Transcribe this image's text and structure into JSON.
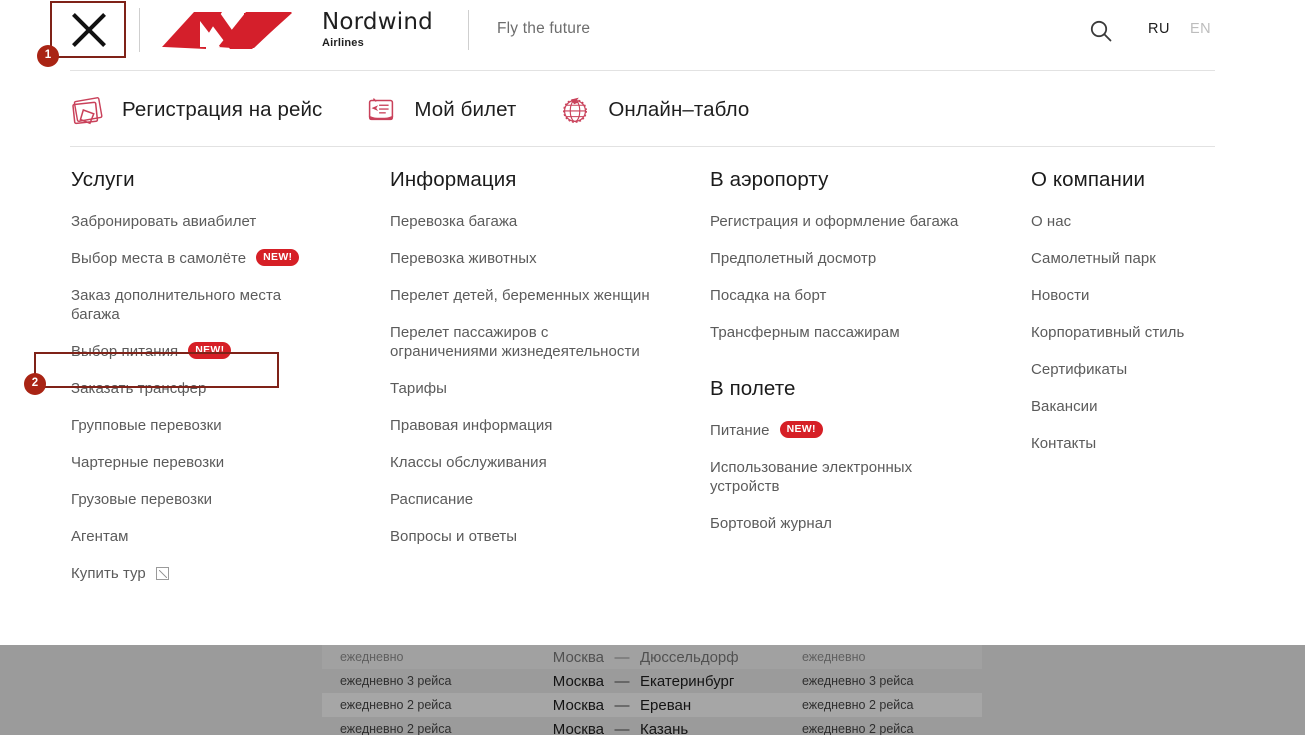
{
  "header": {
    "close_button": "close-icon",
    "brand": {
      "name": "Nordwind",
      "sub": "Airlines"
    },
    "tagline": "Fly the future",
    "search_icon": "search-icon",
    "lang_ru": "RU",
    "lang_en": "EN"
  },
  "quicknav": [
    {
      "icon": "boarding-pass-icon",
      "label": "Регистрация на рейс"
    },
    {
      "icon": "ticket-icon",
      "label": "Мой билет"
    },
    {
      "icon": "globe-plane-icon",
      "label": "Онлайн–табло"
    }
  ],
  "columns": [
    {
      "title": "Услуги",
      "items": [
        {
          "label": "Забронировать авиабилет"
        },
        {
          "label": "Выбор места в самолёте",
          "badge": "NEW!"
        },
        {
          "label": "Заказ дополнительного места\nбагажа"
        },
        {
          "label": "Выбор питания",
          "badge": "NEW!",
          "highlighted": true
        },
        {
          "label": "Заказать трансфер"
        },
        {
          "label": "Групповые перевозки"
        },
        {
          "label": "Чартерные перевозки"
        },
        {
          "label": "Грузовые перевозки"
        },
        {
          "label": "Агентам"
        },
        {
          "label": "Купить тур",
          "external": true
        }
      ]
    },
    {
      "title": "Информация",
      "items": [
        {
          "label": "Перевозка багажа"
        },
        {
          "label": "Перевозка животных"
        },
        {
          "label": "Перелет детей, беременных женщин"
        },
        {
          "label": "Перелет пассажиров с\nограничениями жизнедеятельности"
        },
        {
          "label": "Тарифы"
        },
        {
          "label": "Правовая информация"
        },
        {
          "label": "Классы обслуживания"
        },
        {
          "label": "Расписание"
        },
        {
          "label": "Вопросы и ответы"
        }
      ]
    },
    {
      "title": "В аэропорту",
      "items": [
        {
          "label": "Регистрация и оформление багажа"
        },
        {
          "label": "Предполетный досмотр"
        },
        {
          "label": "Посадка на борт"
        },
        {
          "label": "Трансферным пассажирам"
        }
      ],
      "title2": "В полете",
      "items2": [
        {
          "label": "Питание",
          "badge": "NEW!"
        },
        {
          "label": "Использование электронных\nустройств"
        },
        {
          "label": "Бортовой журнал"
        }
      ]
    },
    {
      "title": "О компании",
      "items": [
        {
          "label": "О нас"
        },
        {
          "label": "Самолетный парк"
        },
        {
          "label": "Новости"
        },
        {
          "label": "Корпоративный стиль"
        },
        {
          "label": "Сертификаты"
        },
        {
          "label": "Вакансии"
        },
        {
          "label": "Контакты"
        }
      ]
    }
  ],
  "markers": [
    {
      "number": "1",
      "target": "close-button"
    },
    {
      "number": "2",
      "target": "menu-item-vybor-pitaniya"
    }
  ],
  "background_schedule": {
    "rows": [
      {
        "left": "ежедневно",
        "from": "Москва",
        "dash": "—",
        "to": "Дюссельдорф",
        "right": "ежедневно",
        "alt": true,
        "clipped": true
      },
      {
        "left": "ежедневно 3 рейса",
        "from": "Москва",
        "dash": "—",
        "to": "Екатеринбург",
        "right": "ежедневно 3 рейса",
        "alt": false
      },
      {
        "left": "ежедневно 2 рейса",
        "from": "Москва",
        "dash": "—",
        "to": "Ереван",
        "right": "ежедневно 2 рейса",
        "alt": true
      },
      {
        "left": "ежедневно 2 рейса",
        "from": "Москва",
        "dash": "—",
        "to": "Казань",
        "right": "ежедневно 2 рейса",
        "alt": false
      }
    ]
  },
  "colors": {
    "brand_red": "#d61f26",
    "highlight_border": "#7f2218",
    "marker": "#a92414",
    "text": "#5b5b5b",
    "heading": "#1b1b1b"
  }
}
